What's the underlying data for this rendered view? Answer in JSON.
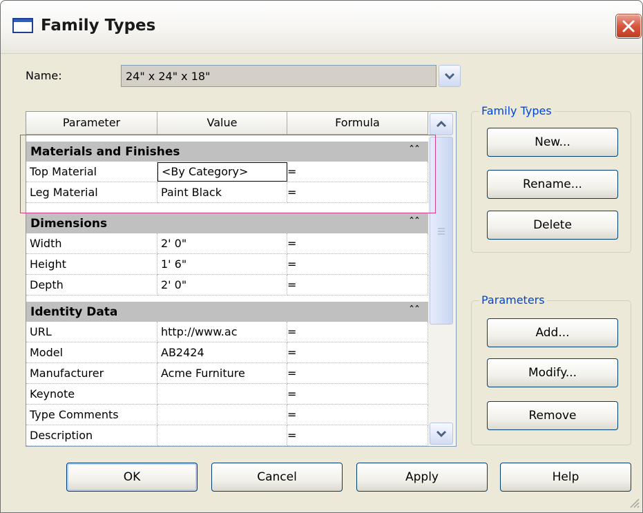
{
  "window": {
    "title": "Family Types",
    "close_icon": "close-icon"
  },
  "name_field": {
    "label": "Name:",
    "value": "24\" x 24\" x 18\""
  },
  "table": {
    "headers": [
      "Parameter",
      "Value",
      "Formula"
    ],
    "groups": [
      {
        "title": "Materials and Finishes",
        "rows": [
          {
            "param": "Top Material",
            "value": "<By Category>",
            "formula": "="
          },
          {
            "param": "Leg Material",
            "value": "Paint Black",
            "formula": "="
          }
        ]
      },
      {
        "title": "Dimensions",
        "rows": [
          {
            "param": "Width",
            "value": "2'  0\"",
            "formula": "="
          },
          {
            "param": "Height",
            "value": "1'  6\"",
            "formula": "="
          },
          {
            "param": "Depth",
            "value": "2'  0\"",
            "formula": "="
          }
        ]
      },
      {
        "title": "Identity Data",
        "rows": [
          {
            "param": "URL",
            "value": "http://www.ac",
            "formula": "="
          },
          {
            "param": "Model",
            "value": "AB2424",
            "formula": "="
          },
          {
            "param": "Manufacturer",
            "value": "Acme Furniture",
            "formula": "="
          },
          {
            "param": "Keynote",
            "value": "",
            "formula": "="
          },
          {
            "param": "Type Comments",
            "value": "",
            "formula": "="
          },
          {
            "param": "Description",
            "value": "",
            "formula": "="
          }
        ]
      }
    ],
    "collapse_glyph": "ˆˆ"
  },
  "family_types_group": {
    "title": "Family Types",
    "buttons": {
      "new": "New...",
      "rename": "Rename...",
      "delete": "Delete"
    }
  },
  "parameters_group": {
    "title": "Parameters",
    "buttons": {
      "add": "Add...",
      "modify": "Modify...",
      "remove": "Remove"
    }
  },
  "footer": {
    "ok": "OK",
    "cancel": "Cancel",
    "apply": "Apply",
    "help": "Help"
  },
  "colors": {
    "highlight": "#d43a8a",
    "group_title": "#0046d5",
    "group_header_bg": "#c0c0c0"
  }
}
